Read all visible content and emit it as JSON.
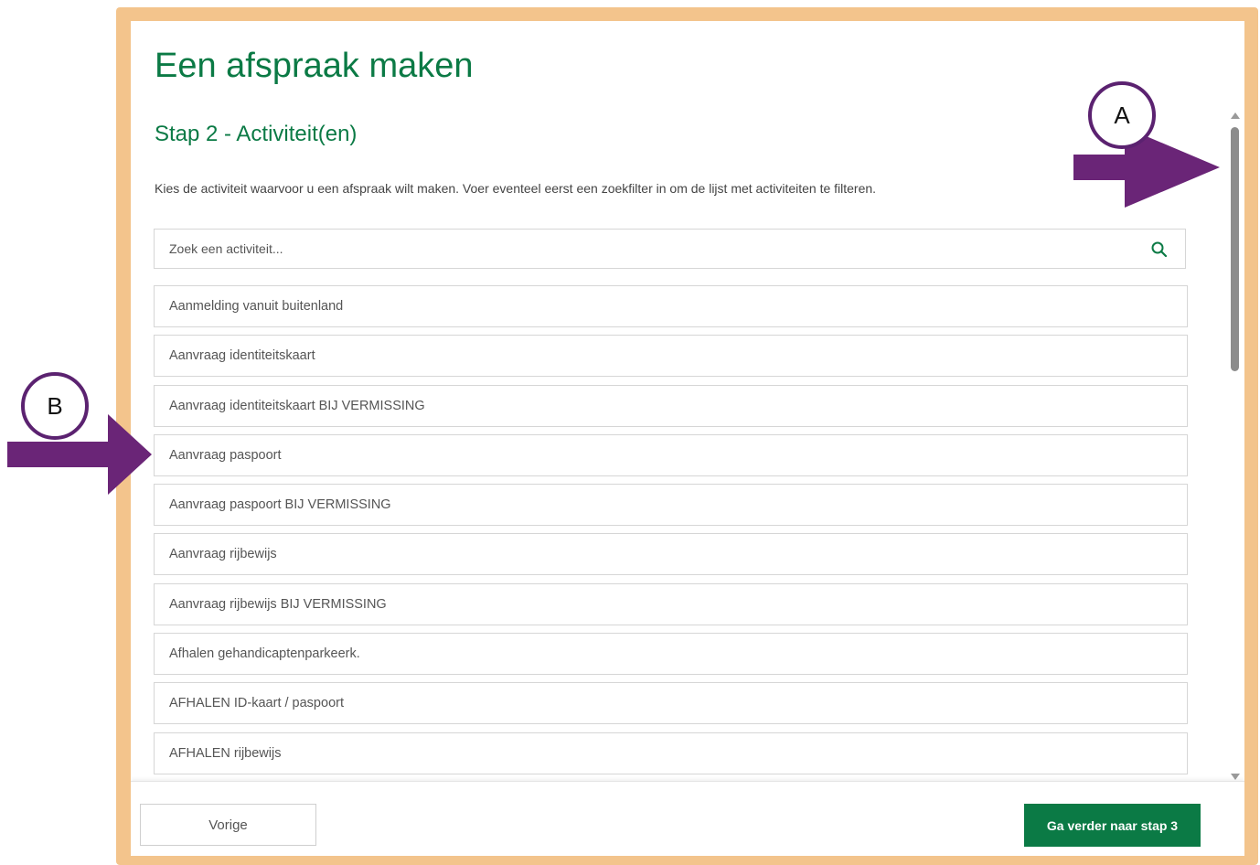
{
  "page": {
    "title": "Een afspraak maken",
    "step_title": "Stap 2 - Activiteit(en)",
    "intro": "Kies de activiteit waarvoor u een afspraak wilt maken. Voer eventeel eerst een zoekfilter in om de lijst met activiteiten te filteren."
  },
  "search": {
    "placeholder": "Zoek een activiteit...",
    "icon": "search-icon"
  },
  "activities": [
    "Aanmelding vanuit buitenland",
    "Aanvraag identiteitskaart",
    "Aanvraag identiteitskaart BIJ VERMISSING",
    "Aanvraag paspoort",
    "Aanvraag paspoort BIJ VERMISSING",
    "Aanvraag rijbewijs",
    "Aanvraag rijbewijs BIJ VERMISSING",
    "Afhalen gehandicaptenparkeerk.",
    "AFHALEN ID-kaart / paspoort",
    "AFHALEN rijbewijs"
  ],
  "footer": {
    "prev_label": "Vorige",
    "next_label": "Ga verder naar stap 3"
  },
  "annotations": {
    "a_label": "A",
    "b_label": "B"
  },
  "colors": {
    "brand_green": "#0b7a45",
    "frame": "#f3c48c",
    "annotation_purple": "#6a2577"
  }
}
